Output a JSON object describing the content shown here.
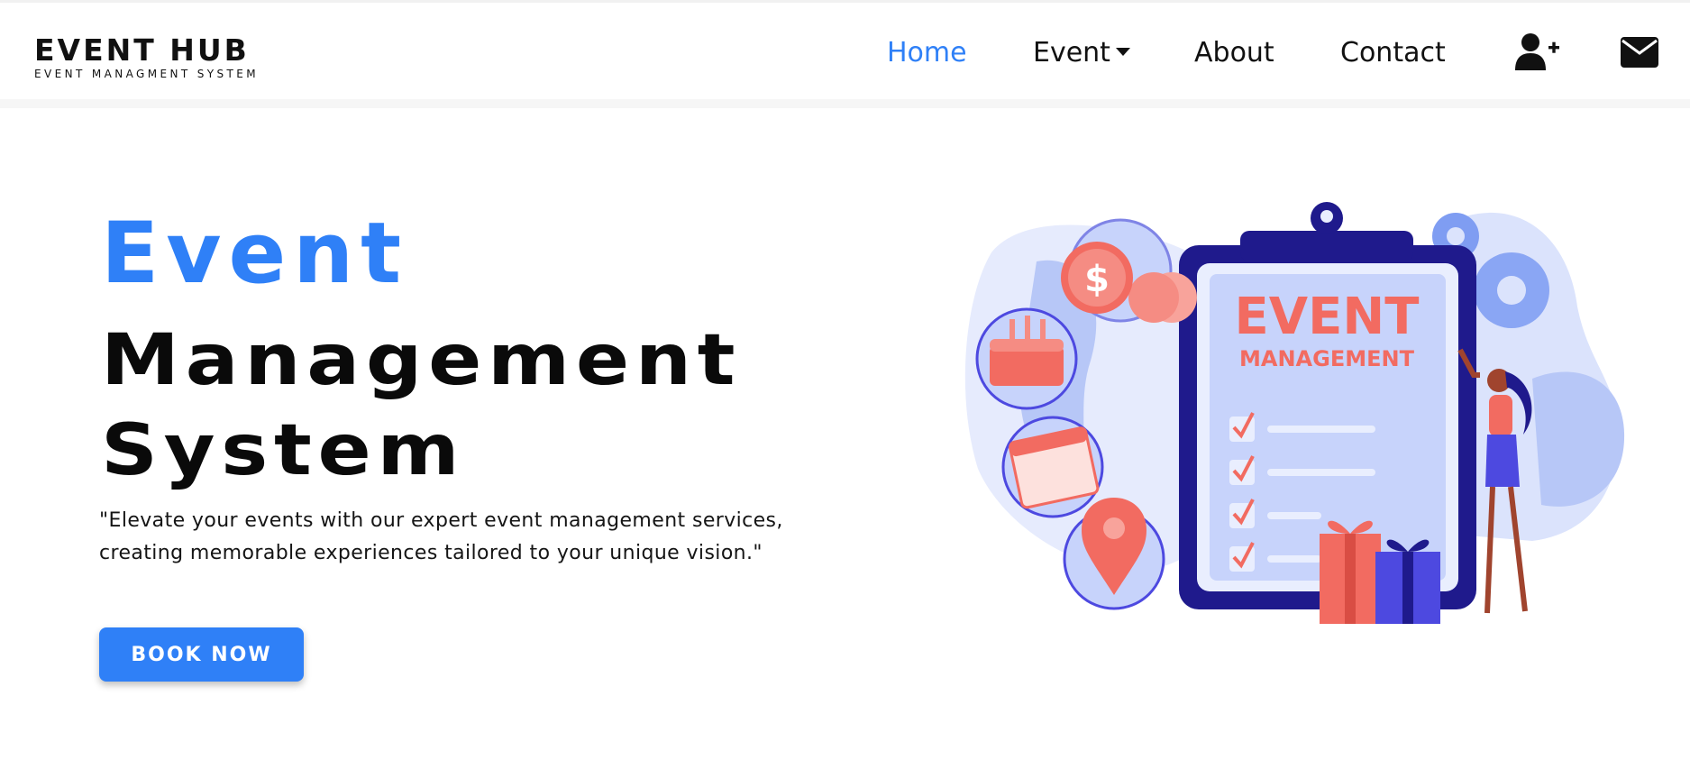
{
  "brand": {
    "title": "EVENT HUB",
    "subtitle": "EVENT MANAGMENT SYSTEM"
  },
  "nav": {
    "links": [
      {
        "label": "Home",
        "active": true
      },
      {
        "label": "Event",
        "has_dropdown": true
      },
      {
        "label": "About"
      },
      {
        "label": "Contact"
      }
    ],
    "icons": [
      "user-plus-icon",
      "envelope-icon"
    ]
  },
  "hero": {
    "title_line1": "Event",
    "title_line2": "Management",
    "title_line3": "System",
    "tagline_line1": "\"Elevate your events with our expert event management services,",
    "tagline_line2": "creating memorable experiences tailored to your unique vision.\"",
    "button_label": "BOOK NOW"
  },
  "illustration": {
    "clipboard_title": "EVENT",
    "clipboard_subtitle": "MANAGEMENT",
    "coin_symbol": "$"
  },
  "colors": {
    "accent": "#2f80f7",
    "illustration_coral": "#f26b61",
    "illustration_navy": "#1f1a8c",
    "illustration_light": "#c7d3fb"
  }
}
